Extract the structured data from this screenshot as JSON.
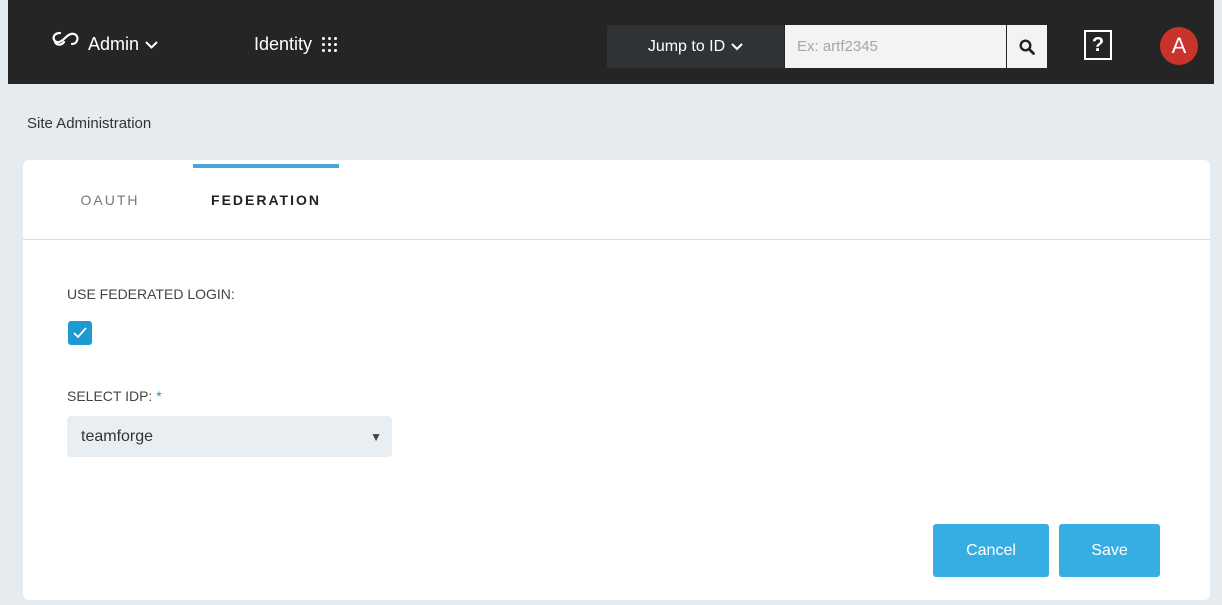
{
  "header": {
    "admin_label": "Admin",
    "identity_label": "Identity",
    "jump_label": "Jump to ID",
    "search_placeholder": "Ex: artf2345",
    "help_label": "?",
    "avatar_letter": "A"
  },
  "breadcrumb": "Site Administration",
  "tabs": [
    {
      "label": "OAUTH",
      "active": false
    },
    {
      "label": "FEDERATION",
      "active": true
    }
  ],
  "form": {
    "federated_login_label": "USE FEDERATED LOGIN:",
    "federated_login_checked": true,
    "idp_label": "SELECT IDP:",
    "idp_required_mark": "*",
    "idp_value": "teamforge"
  },
  "actions": {
    "cancel_label": "Cancel",
    "save_label": "Save"
  },
  "colors": {
    "topbar": "#252525",
    "accent": "#37aee2",
    "avatar": "#c8342c",
    "page_bg": "#e5ebee"
  }
}
